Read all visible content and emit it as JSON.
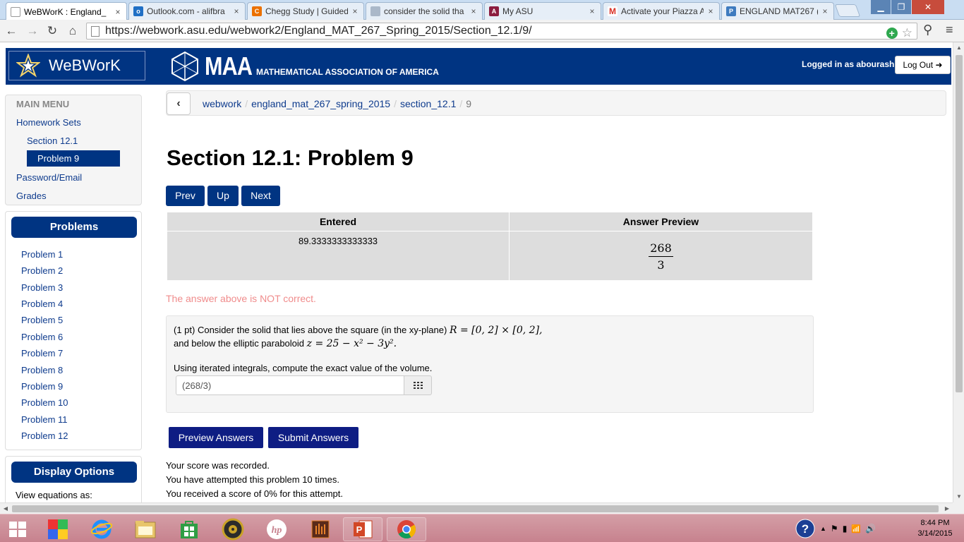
{
  "browser": {
    "tabs": [
      {
        "title": "WeBWorK : England_",
        "icon": "page-icon",
        "active": true
      },
      {
        "title": "Outlook.com - alifbra",
        "icon": "outlook-icon",
        "active": false
      },
      {
        "title": "Chegg Study | Guided",
        "icon": "chegg-icon",
        "active": false
      },
      {
        "title": "consider the solid tha",
        "icon": "search-result-icon",
        "active": false
      },
      {
        "title": "My ASU",
        "icon": "asu-icon",
        "active": false
      },
      {
        "title": "Activate your Piazza A",
        "icon": "gmail-icon",
        "active": false
      },
      {
        "title": "ENGLAND MAT267 (",
        "icon": "piazza-icon",
        "active": false
      }
    ],
    "url": "https://webwork.asu.edu/webwork2/England_MAT_267_Spring_2015/Section_12.1/9/",
    "close_glyph": "×"
  },
  "header": {
    "brand": "WeBWorK",
    "maa_big": "MAA",
    "maa_small": "MATHEMATICAL ASSOCIATION OF AMERICA",
    "logged_in": "Logged in as abourash.",
    "logout": "Log Out"
  },
  "sidebar": {
    "main_menu": "MAIN MENU",
    "homework_sets": "Homework Sets",
    "section": "Section 12.1",
    "problem": "Problem 9",
    "password_email": "Password/Email",
    "grades": "Grades",
    "problems_title": "Problems",
    "problems": [
      "Problem 1",
      "Problem 2",
      "Problem 3",
      "Problem 4",
      "Problem 5",
      "Problem 6",
      "Problem 7",
      "Problem 8",
      "Problem 9",
      "Problem 10",
      "Problem 11",
      "Problem 12"
    ],
    "display_options": "Display Options",
    "view_equations": "View equations as:"
  },
  "breadcrumb": {
    "items": [
      "webwork",
      "england_mat_267_spring_2015",
      "section_12.1"
    ],
    "current": "9",
    "separator": "/"
  },
  "main": {
    "title": "Section 12.1: Problem 9",
    "prev": "Prev",
    "up": "Up",
    "next": "Next",
    "table": {
      "col_entered": "Entered",
      "col_preview": "Answer Preview",
      "entered_value": "89.3333333333333",
      "preview_numerator": "268",
      "preview_denominator": "3"
    },
    "result_message": "The answer above is NOT correct.",
    "problem": {
      "line1_text": "(1 pt) Consider the solid that lies above the square (in the xy-plane)",
      "line1_math": "R = [0, 2] × [0, 2],",
      "line2_text": "and below the elliptic paraboloid",
      "line2_math": "z = 25 − x² − 3y².",
      "line3_text": "Using iterated integrals, compute the exact value of the volume.",
      "answer_value": "(268/3)"
    },
    "preview_button": "Preview Answers",
    "submit_button": "Submit Answers",
    "score_lines": [
      "Your score was recorded.",
      "You have attempted this problem 10 times.",
      "You received a score of 0% for this attempt."
    ]
  },
  "taskbar": {
    "time": "8:44 PM",
    "date": "3/14/2015"
  }
}
